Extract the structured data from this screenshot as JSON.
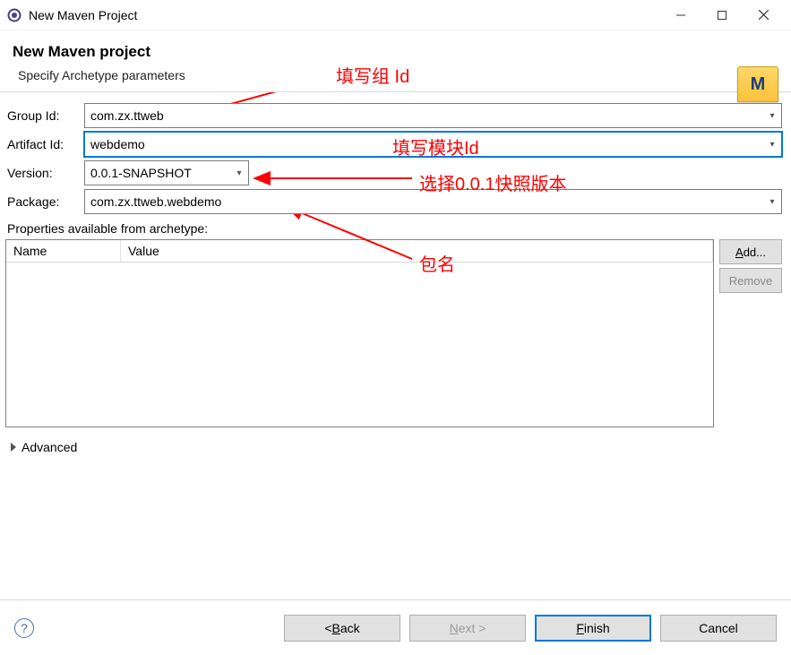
{
  "window": {
    "title": "New Maven Project"
  },
  "header": {
    "title": "New Maven project",
    "subtitle": "Specify Archetype parameters"
  },
  "form": {
    "group_id_label": "Group Id:",
    "group_id_value": "com.zx.ttweb",
    "artifact_id_label": "Artifact Id:",
    "artifact_id_value": "webdemo",
    "version_label": "Version:",
    "version_value": "0.0.1-SNAPSHOT",
    "package_label": "Package:",
    "package_value": "com.zx.ttweb.webdemo"
  },
  "properties": {
    "title": "Properties available from archetype:",
    "col_name": "Name",
    "col_value": "Value",
    "add_label": "Add...",
    "remove_label": "Remove"
  },
  "advanced_label": "Advanced",
  "footer": {
    "back": "Back",
    "next": "Next >",
    "finish": "Finish",
    "cancel": "Cancel"
  },
  "annotations": {
    "group": "填写组 Id",
    "artifact": "填写模块Id",
    "version": "选择0.0.1快照版本",
    "package": "包名"
  }
}
